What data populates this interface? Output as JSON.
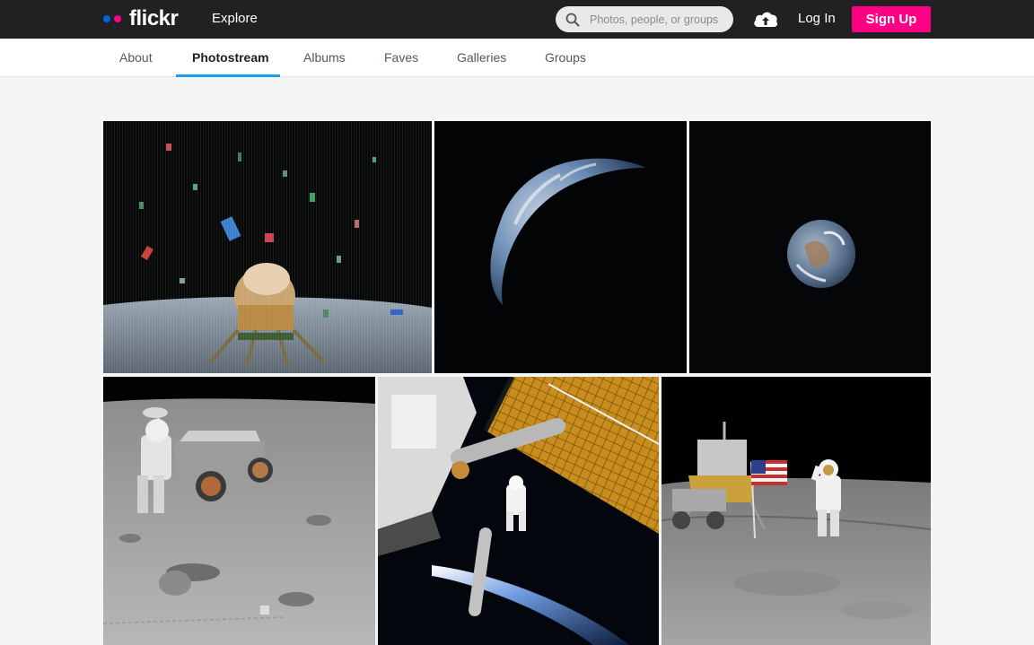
{
  "header": {
    "logo_text": "flickr",
    "logo_colors": {
      "blue": "#0063dc",
      "pink": "#ff0084"
    },
    "explore_label": "Explore",
    "search_placeholder": "Photos, people, or groups",
    "login_label": "Log In",
    "signup_label": "Sign Up",
    "signup_color": "#ff0084",
    "upload_icon": "cloud-upload-icon"
  },
  "subnav": {
    "tabs": [
      {
        "label": "About"
      },
      {
        "label": "Photostream",
        "active": true
      },
      {
        "label": "Albums"
      },
      {
        "label": "Faves"
      },
      {
        "label": "Galleries"
      },
      {
        "label": "Groups"
      }
    ],
    "active_color": "#1c9be9"
  },
  "photos": [
    {
      "subject": "lunar-module-liftoff"
    },
    {
      "subject": "earth-crescent"
    },
    {
      "subject": "earthrise"
    },
    {
      "subject": "astronaut-lunar-rover"
    },
    {
      "subject": "spacewalk-station-arm"
    },
    {
      "subject": "astronaut-flag-salute"
    }
  ]
}
